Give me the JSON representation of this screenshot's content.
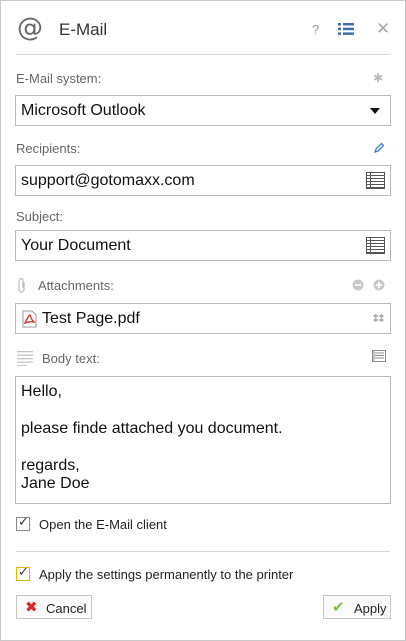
{
  "dialog": {
    "title": "E-Mail",
    "help_glyph": "?",
    "close_glyph": "✕"
  },
  "email_system": {
    "label": "E-Mail system:",
    "value": "Microsoft Outlook"
  },
  "recipients": {
    "label": "Recipients:",
    "value": "support@gotomaxx.com"
  },
  "subject": {
    "label": "Subject:",
    "value": "Your Document"
  },
  "attachments": {
    "label": "Attachments:",
    "file": "Test Page.pdf"
  },
  "body_text": {
    "label": "Body text:",
    "lines": [
      "Hello,",
      "",
      "please finde attached you document.",
      "",
      "regards,",
      "Jane Doe"
    ]
  },
  "options": {
    "open_client_label": "Open the E-Mail client",
    "open_client_checked": true,
    "apply_permanently_label": "Apply the settings permanently to the printer",
    "apply_permanently_checked": true
  },
  "buttons": {
    "cancel_label": "Cancel",
    "apply_label": "Apply"
  },
  "colors": {
    "cancel_icon": "#d9262b",
    "apply_icon": "#7cc142",
    "pdf_icon": "#d12f2f",
    "edit_icon": "#3d7ec8",
    "highlight_checkbox": "#e3b400"
  }
}
